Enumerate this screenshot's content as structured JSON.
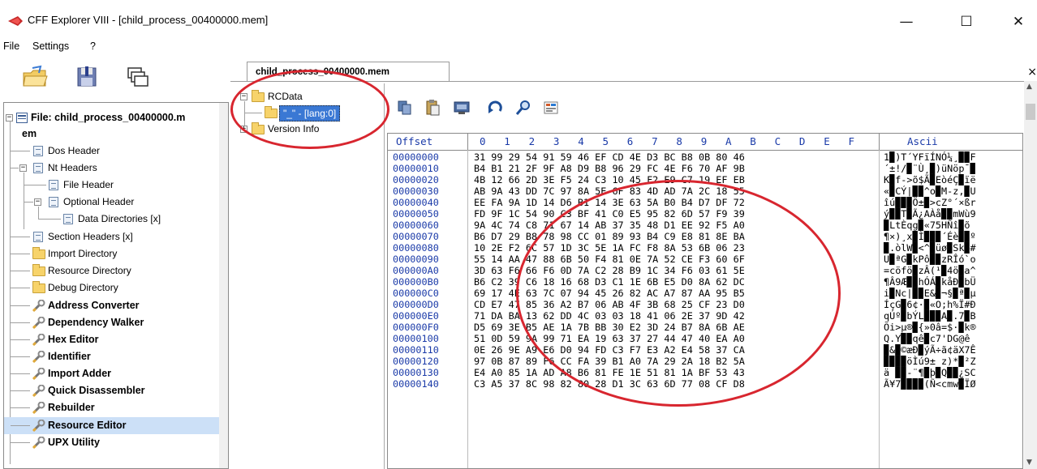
{
  "window": {
    "title": "CFF Explorer VIII - [child_process_00400000.mem]",
    "minimize_icon": "minimize-icon",
    "maximize_icon": "maximize-icon",
    "close_icon": "close-icon",
    "minimize_glyph": "—",
    "maximize_glyph": "☐",
    "close_glyph": "✕"
  },
  "menu": {
    "items": [
      "File",
      "Settings",
      "?"
    ]
  },
  "toolbar": {
    "icons": [
      "open-folder-icon",
      "save-icon",
      "windows-icon"
    ]
  },
  "left_tree": {
    "root_label_line1": "File: child_process_00400000.m",
    "root_label_line2": "em",
    "items": [
      {
        "label": "Dos Header",
        "icon": "doc-icon"
      },
      {
        "label": "Nt Headers",
        "icon": "doc-icon"
      },
      {
        "label": "File Header",
        "icon": "doc-icon"
      },
      {
        "label": "Optional Header",
        "icon": "doc-icon"
      },
      {
        "label": "Data Directories [x]",
        "icon": "doc-icon"
      },
      {
        "label": "Section Headers [x]",
        "icon": "doc-icon"
      },
      {
        "label": "Import Directory",
        "icon": "folder-icon"
      },
      {
        "label": "Resource Directory",
        "icon": "folder-icon"
      },
      {
        "label": "Debug Directory",
        "icon": "folder-icon"
      },
      {
        "label": "Address Converter",
        "icon": "tool-icon"
      },
      {
        "label": "Dependency Walker",
        "icon": "tool-icon"
      },
      {
        "label": "Hex Editor",
        "icon": "tool-icon"
      },
      {
        "label": "Identifier",
        "icon": "tool-icon"
      },
      {
        "label": "Import Adder",
        "icon": "tool-icon"
      },
      {
        "label": "Quick Disassembler",
        "icon": "tool-icon"
      },
      {
        "label": "Rebuilder",
        "icon": "tool-icon"
      },
      {
        "label": "Resource Editor",
        "icon": "tool-icon"
      },
      {
        "label": "UPX Utility",
        "icon": "tool-icon"
      }
    ]
  },
  "tab": {
    "label": "child_process_00400000.mem",
    "close_glyph": "×"
  },
  "resource_tree": {
    "root": "RCData",
    "child": "\"_\" - [lang:0]",
    "sibling": "Version Info"
  },
  "hex_toolbar": {
    "icons": [
      "copy-icon",
      "paste-icon",
      "hex-dump-icon",
      "goto-icon",
      "search-icon",
      "select-icon"
    ]
  },
  "hex": {
    "header_offset": "Offset",
    "header_cols": [
      "0",
      "1",
      "2",
      "3",
      "4",
      "5",
      "6",
      "7",
      "8",
      "9",
      "A",
      "B",
      "C",
      "D",
      "E",
      "F"
    ],
    "header_ascii": "Ascii",
    "rows": [
      {
        "offset": "00000000",
        "bytes": "31 99 29 54 91 59 46 EF CD 4E D3 BC B8 0B 80 46",
        "ascii": "1▉)T´YFïÍNÓ¼¸▉▉F"
      },
      {
        "offset": "00000010",
        "bytes": "B4 B1 21 2F 9F A8 D9 B8 96 29 FC 4E F6 70 AF 9B",
        "ascii": "´±!/▉¨Ù¸▉)üNöp¯▉"
      },
      {
        "offset": "00000020",
        "bytes": "4B 12 66 2D 3E F5 24 C3 10 45 F2 E9 C7 19 EF EB",
        "ascii": "K▉f->õ$Ã▉EòéÇ▉ïë"
      },
      {
        "offset": "00000030",
        "bytes": "AB 9A 43 DD 7C 97 8A 5E 6F 83 4D AD 7A 2C 18 55",
        "ascii": "«▉CÝ|▉▉^o▉M-z,▉U"
      },
      {
        "offset": "00000040",
        "bytes": "EE FA 9A 1D 14 D6 B1 14 3E 63 5A B0 B4 D7 DF 72",
        "ascii": "îú▉▉▉Ö±▉>cZ°´×ßr"
      },
      {
        "offset": "00000050",
        "bytes": "FD 9F 1C 54 90 C3 BF 41 C0 E5 95 82 6D 57 F9 39",
        "ascii": "ý▉▉T▉Ã¿AÀå▉▉mWù9"
      },
      {
        "offset": "00000060",
        "bytes": "9A 4C 74 C8 71 67 14 AB 37 35 48 D1 EE 92 F5 A0",
        "ascii": "▉LtÈqg▉«75HÑî▉õ "
      },
      {
        "offset": "00000070",
        "bytes": "B6 D7 29 B8 78 98 CC 01 89 93 B4 C9 E8 81 8E BA",
        "ascii": "¶×)¸x▉Ì▉▉▉´Éè▉▉º"
      },
      {
        "offset": "00000080",
        "bytes": "10 2E F2 6C 57 1D 3C 5E 1A FC F8 8A 53 6B 06 23",
        "ascii": "▉.òlW▉<^▉üø▉Sk▉#"
      },
      {
        "offset": "00000090",
        "bytes": "55 14 AA 47 88 6B 50 F4 81 0E 7A 52 CE F3 60 6F",
        "ascii": "U▉ªG▉kPô▉▉zRÎó`o"
      },
      {
        "offset": "000000A0",
        "bytes": "3D 63 F6 66 F6 0D 7A C2 28 B9 1C 34 F6 03 61 5E",
        "ascii": "=cöfö▉zÂ(¹▉4ö▉a^"
      },
      {
        "offset": "000000B0",
        "bytes": "B6 C2 39 C6 18 16 68 D3 C1 1E 6B E5 D0 8A 62 DC",
        "ascii": "¶Â9Æ▉▉hÓÁ▉kåÐ▉bÜ"
      },
      {
        "offset": "000000C0",
        "bytes": "69 17 4E 63 7C 07 94 45 26 82 AC A7 87 AA 95 B5",
        "ascii": "i▉Nc|▉▉E&▉¬§▉ª▉µ"
      },
      {
        "offset": "000000D0",
        "bytes": "CD E7 47 85 36 A2 B7 06 AB 4F 3B 68 25 CF 23 D0",
        "ascii": "ÍçG▉6¢·▉«O;h%Ï#Ð"
      },
      {
        "offset": "000000E0",
        "bytes": "71 DA BA 13 62 DD 4C 03 03 18 41 06 2E 37 9D 42",
        "ascii": "qÚº▉bÝL▉▉▉A▉.7▉B"
      },
      {
        "offset": "000000F0",
        "bytes": "D5 69 3E B5 AE 1A 7B BB 30 E2 3D 24 B7 8A 6B AE",
        "ascii": "Õi>µ®▉{»0â=$·▉k®"
      },
      {
        "offset": "00000100",
        "bytes": "51 0D 59 9A 99 71 EA 19 63 37 27 44 47 40 EA A0",
        "ascii": "Q.Y▉▉qê▉c7'DG@ê "
      },
      {
        "offset": "00000110",
        "bytes": "0E 26 9E A9 E6 D0 94 FD C3 F7 E3 A2 E4 58 37 CA",
        "ascii": "▉&▉©æÐ▉ýÃ÷ã¢äX7Ê"
      },
      {
        "offset": "00000120",
        "bytes": "97 0B 87 89 F6 CC FA 39 B1 A0 7A 29 2A 18 B2 5A",
        "ascii": "▉▉▉▉öÌú9± z)*▉²Z"
      },
      {
        "offset": "00000130",
        "bytes": "E4 A0 85 1A AD A8 B6 81 FE 1E 51 81 1A BF 53 43",
        "ascii": "ä ▉▉-¨¶▉þ▉Q▉▉¿SC"
      },
      {
        "offset": "00000140",
        "bytes": "C3 A5 37 8C 98 82 80 28 D1 3C 63 6D 77 08 CF D8",
        "ascii": "Ã¥7▉▉▉▉(Ñ<cmw▉ÏØ"
      }
    ]
  },
  "colors": {
    "offset_blue": "#1a3aa8",
    "selection_blue": "#cce0f7",
    "annotation_red": "#d8262f",
    "folder_yellow": "#f7d36a"
  }
}
